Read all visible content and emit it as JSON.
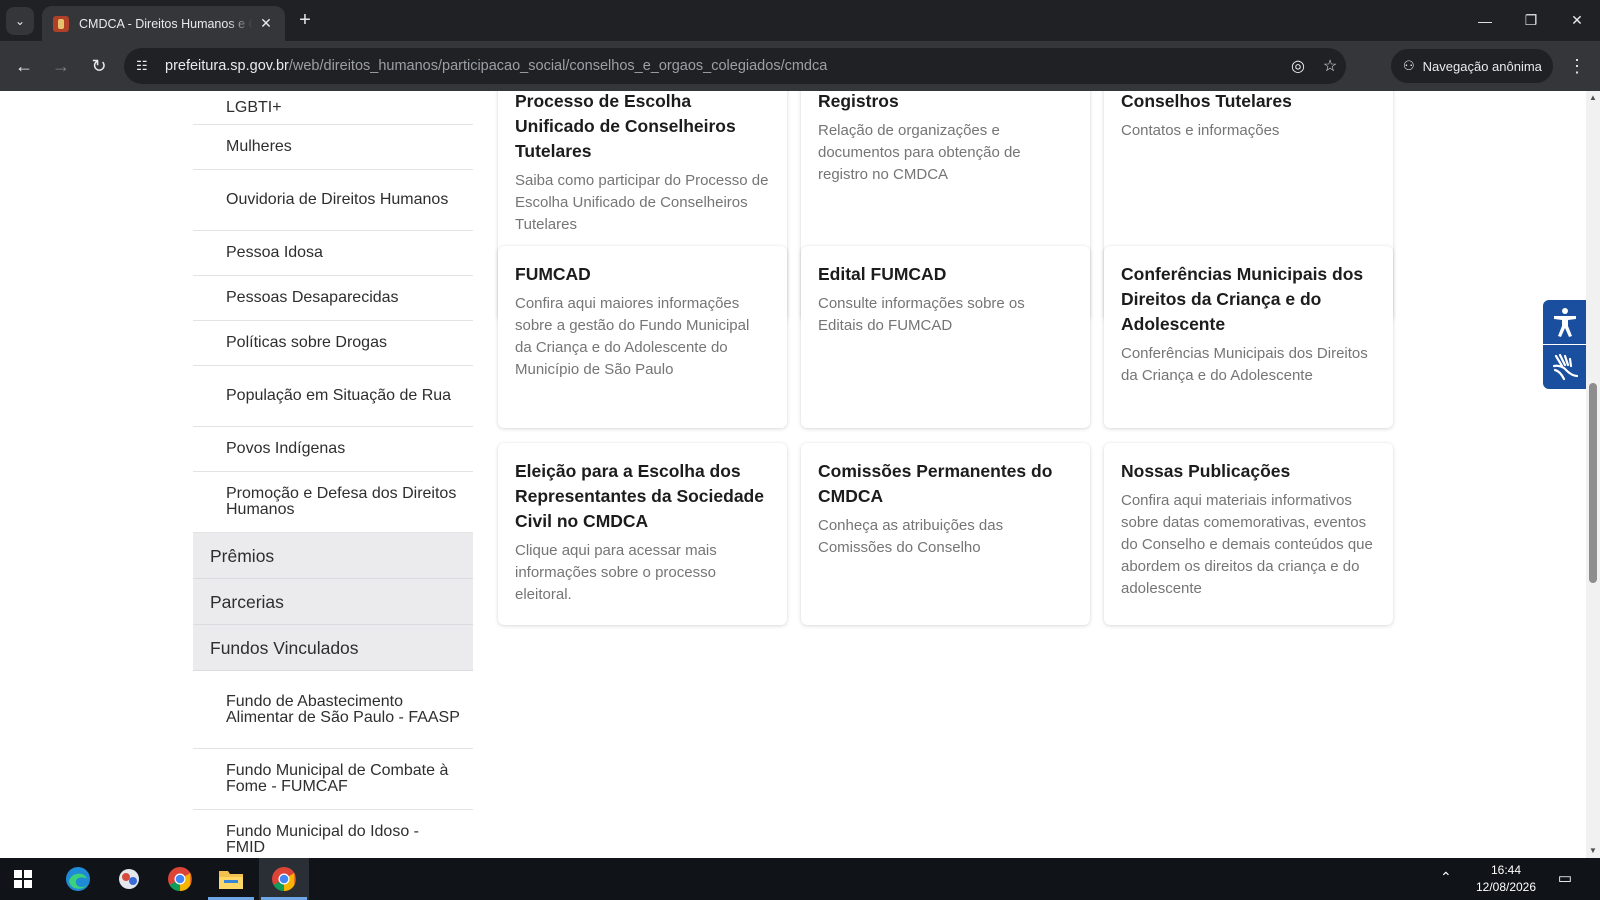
{
  "browser": {
    "tab_title": "CMDCA - Direitos Humanos e Cidadania",
    "new_tab_label": "+",
    "url_host": "prefeitura.sp.gov.br",
    "url_path": "/web/direitos_humanos/participacao_social/conselhos_e_orgaos_colegiados/cmdca",
    "incognito_label": "Navegação anônima",
    "icons": [
      "tab-search-icon",
      "close-icon",
      "back-arrow-icon",
      "forward-arrow-icon",
      "reload-icon",
      "site-info-icon",
      "eye-slash-icon",
      "star-icon",
      "incognito-icon",
      "more-vert-icon"
    ]
  },
  "sidebar": {
    "items": [
      {
        "label": "LGBTI+"
      },
      {
        "label": "Mulheres"
      },
      {
        "label": "Ouvidoria de Direitos Humanos"
      },
      {
        "label": "Pessoa Idosa"
      },
      {
        "label": "Pessoas Desaparecidas"
      },
      {
        "label": "Políticas sobre Drogas"
      },
      {
        "label": "População em Situação de Rua"
      },
      {
        "label": "Povos Indígenas"
      },
      {
        "label": "Promoção e Defesa dos Direitos Humanos"
      }
    ],
    "sections": [
      {
        "label": "Prêmios"
      },
      {
        "label": "Parcerias"
      },
      {
        "label": "Fundos Vinculados"
      }
    ],
    "fund_items": [
      {
        "label": "Fundo de Abastecimento Alimentar de São Paulo - FAASP"
      },
      {
        "label": "Fundo Municipal de Combate à Fome - FUMCAF"
      },
      {
        "label": "Fundo Municipal do Idoso - FMID"
      }
    ]
  },
  "cards": [
    {
      "title": "Processo de Escolha Unificado de Conselheiros Tutelares",
      "desc": "Saiba como participar do Processo de Escolha Unificado de Conselheiros Tutelares"
    },
    {
      "title": "Registros",
      "desc": "Relação de organizações e documentos para obtenção de registro no CMDCA"
    },
    {
      "title": "Conselhos Tutelares",
      "desc": "Contatos e informações"
    },
    {
      "title": "FUMCAD",
      "desc": "Confira aqui maiores informações sobre a gestão do Fundo Municipal da Criança e do Adolescente do Município de São Paulo"
    },
    {
      "title": "Edital FUMCAD",
      "desc": "Consulte informações sobre os Editais do FUMCAD"
    },
    {
      "title": "Conferências Municipais dos Direitos da Criança e do Adolescente",
      "desc": "Conferências Municipais dos Direitos da Criança e do Adolescente"
    },
    {
      "title": "Eleição para a Escolha dos Representantes da Sociedade Civil no CMDCA",
      "desc": "Clique aqui para acessar mais informações sobre o processo eleitoral."
    },
    {
      "title": "Comissões Permanentes do CMDCA",
      "desc": "Conheça as atribuições das Comissões do Conselho"
    },
    {
      "title": "Nossas Publicações",
      "desc": "Confira aqui materiais informativos sobre datas comemorativas, eventos do Conselho e demais conteúdos que abordem os direitos da criança e do adolescente"
    }
  ],
  "accessibility": {
    "accessibility_icon": "accessibility-icon",
    "sign_language_icon": "sign-language-icon",
    "color": "#1a4e9e"
  },
  "taskbar": {
    "time": "16:44",
    "date": "12/08/2026",
    "apps": [
      "windows-start-icon",
      "edge-icon",
      "app-icon",
      "chrome-icon",
      "file-explorer-icon",
      "chrome-icon"
    ]
  }
}
